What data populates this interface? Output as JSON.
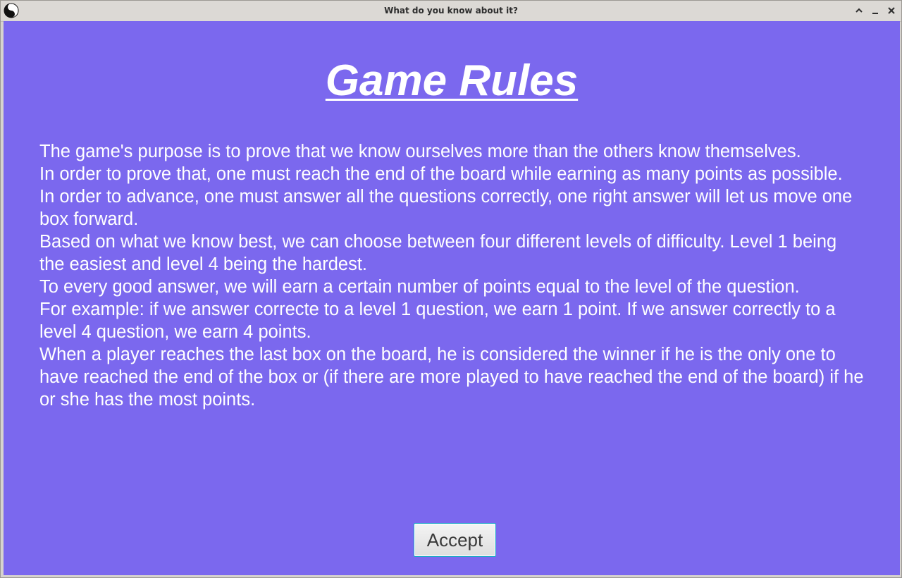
{
  "window": {
    "title": "What do you know about it?",
    "app_icon": "yin-yang-icon",
    "controls": [
      "maximize-icon",
      "minimize-icon",
      "close-icon"
    ]
  },
  "colors": {
    "background": "#7b68ee",
    "text": "#ffffff",
    "titlebar": "#dcd9d5",
    "button_border": "#1fa8c8"
  },
  "page": {
    "heading": "Game Rules",
    "rules": [
      "The game's purpose is to prove that we know ourselves more than the others know themselves.",
      "In order to prove that, one must reach the end of the board while earning as many points as possible.",
      "In order to advance, one must answer all the questions correctly, one right answer will let us move one box forward.",
      "Based on what we know best, we can choose between four different levels of difficulty. Level 1 being the easiest and level 4 being the hardest.",
      "To every good answer, we will earn a certain number of points equal to the level of the question.",
      "For example: if we answer correcte to a level 1 question, we earn 1 point. If we answer correctly to a level 4 question, we earn 4 points.",
      "When a player reaches the last box on the board, he is considered the winner if he is the only one to have reached the end of the box or (if there are more played to have reached the end of the board) if he or she has the most points."
    ],
    "accept_label": "Accept"
  }
}
